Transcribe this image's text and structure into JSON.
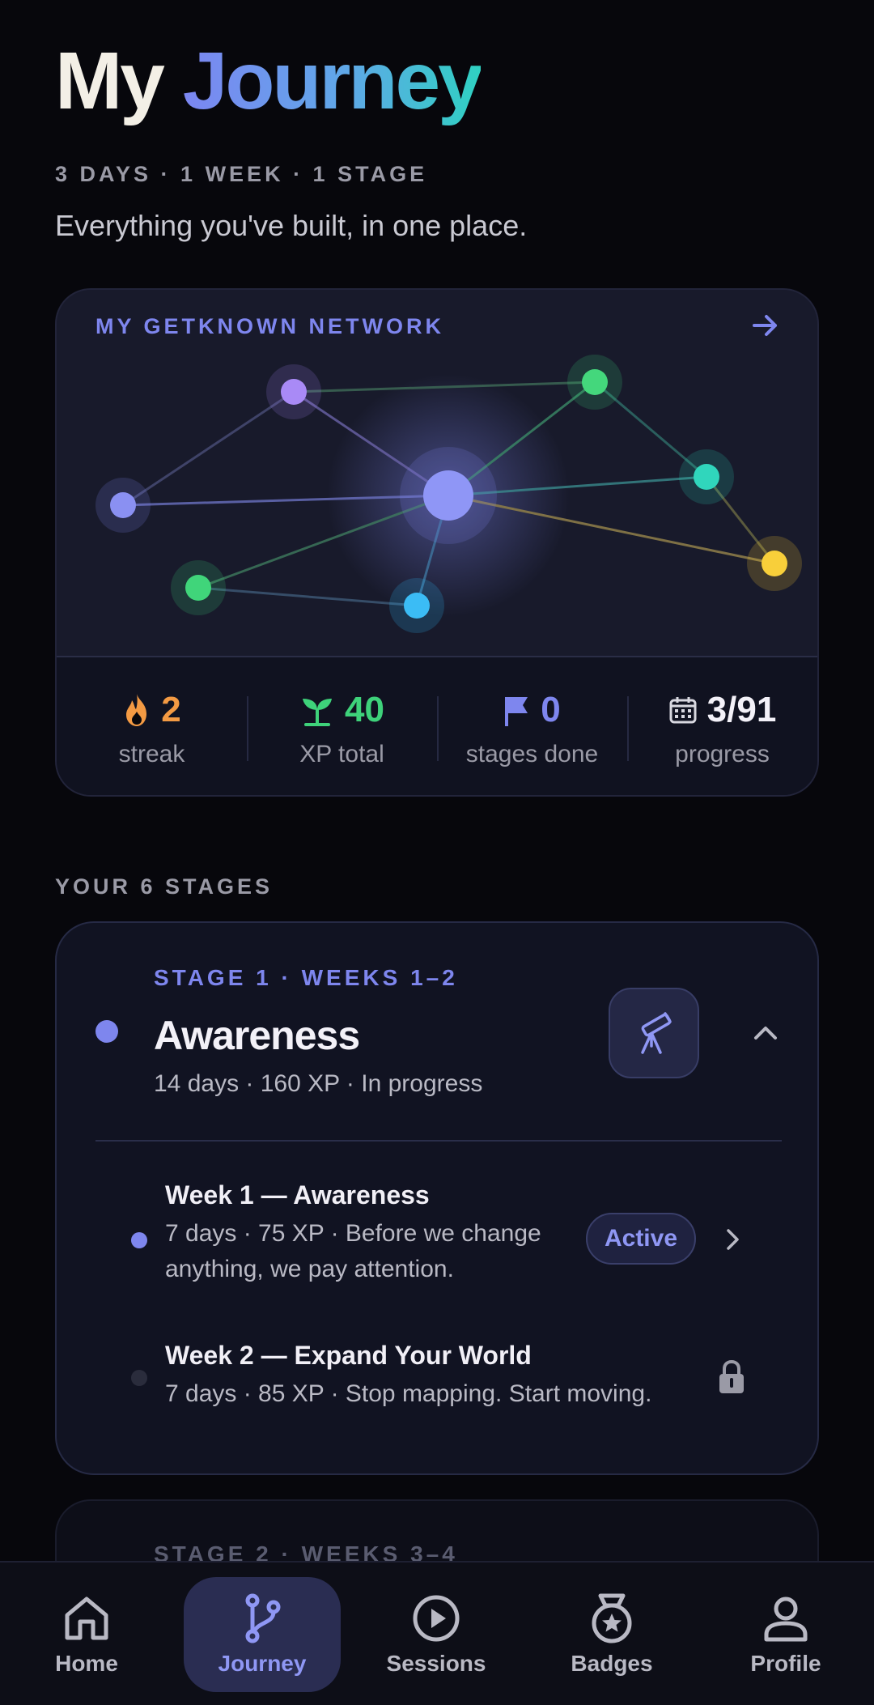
{
  "header": {
    "title_part1": "My",
    "title_part2": "Journey",
    "meta": "3 DAYS · 1 WEEK · 1 STAGE",
    "subtitle": "Everything you've built, in one place."
  },
  "network": {
    "label": "MY GETKNOWN NETWORK",
    "arrow_icon": "arrow-right-icon"
  },
  "stats": [
    {
      "value": "2",
      "label": "streak",
      "icon": "flame-icon",
      "color": "#f39a43"
    },
    {
      "value": "40",
      "label": "XP total",
      "icon": "sprout-icon",
      "color": "#3ed27a"
    },
    {
      "value": "0",
      "label": "stages done",
      "icon": "flag-icon",
      "color": "#7e86ee"
    },
    {
      "value": "3/91",
      "label": "progress",
      "icon": "calendar-icon",
      "color": "#f3f1f8"
    }
  ],
  "stages": {
    "heading": "YOUR 6 STAGES",
    "stage1": {
      "kicker": "STAGE 1 · WEEKS 1–2",
      "name": "Awareness",
      "meta": "14 days · 160 XP · In progress",
      "icon": "telescope-icon",
      "weeks": [
        {
          "title": "Week 1 — Awareness",
          "desc": "7 days · 75 XP · Before we change anything, we pay attention.",
          "badge": "Active"
        },
        {
          "title": "Week 2 — Expand Your World",
          "desc": "7 days · 85 XP · Stop mapping. Start moving."
        }
      ]
    },
    "stage2": {
      "kicker": "STAGE 2 · WEEKS 3–4"
    }
  },
  "nav": [
    {
      "label": "Home",
      "icon": "home-icon"
    },
    {
      "label": "Journey",
      "icon": "journey-branch-icon"
    },
    {
      "label": "Sessions",
      "icon": "play-circle-icon"
    },
    {
      "label": "Badges",
      "icon": "medal-icon"
    },
    {
      "label": "Profile",
      "icon": "user-icon"
    }
  ],
  "colors": {
    "accent": "#7e86ee",
    "background": "#07070c",
    "card": "#181a2b"
  }
}
